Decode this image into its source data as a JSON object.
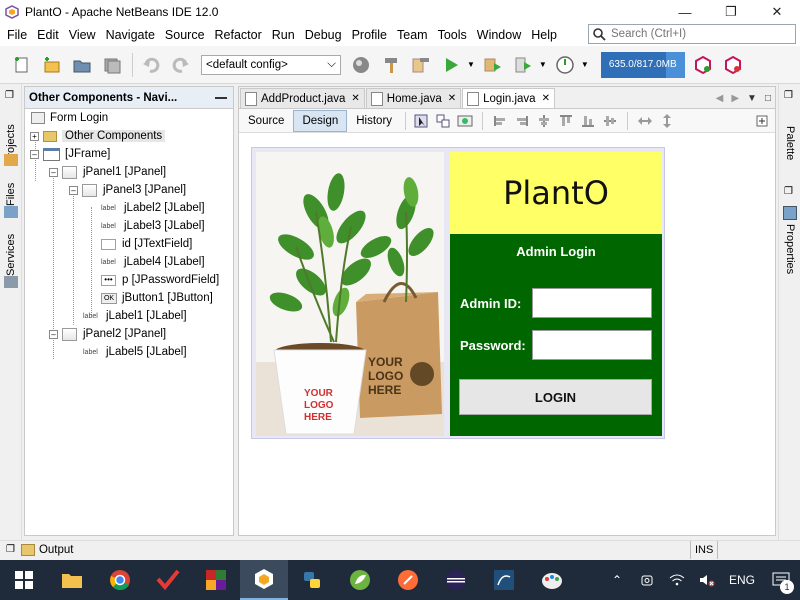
{
  "window": {
    "title": "PlantO - Apache NetBeans IDE 12.0",
    "buttons": [
      "minimize",
      "maximize",
      "close"
    ]
  },
  "menu": {
    "items": [
      "File",
      "Edit",
      "View",
      "Navigate",
      "Source",
      "Refactor",
      "Run",
      "Debug",
      "Profile",
      "Team",
      "Tools",
      "Window",
      "Help"
    ],
    "search_placeholder": "Search (Ctrl+I)"
  },
  "toolbar": {
    "config": "<default config>",
    "memory_text": "635.0/817.0MB",
    "memory_fraction": 0.78
  },
  "left_tabs": [
    "Projects",
    "Files",
    "Services"
  ],
  "right_tabs": [
    "Palette",
    "Properties"
  ],
  "navigator": {
    "title": "Other Components - Navi...",
    "nodes": [
      {
        "label": "Form Login"
      },
      {
        "label": "Other Components"
      },
      {
        "label": "[JFrame]"
      },
      {
        "label": "jPanel1 [JPanel]"
      },
      {
        "label": "jPanel3 [JPanel]"
      },
      {
        "label": "jLabel2 [JLabel]"
      },
      {
        "label": "jLabel3 [JLabel]"
      },
      {
        "label": "id [JTextField]"
      },
      {
        "label": "jLabel4 [JLabel]"
      },
      {
        "label": "p [JPasswordField]"
      },
      {
        "label": "jButton1 [JButton]"
      },
      {
        "label": "jLabel1 [JLabel]"
      },
      {
        "label": "jPanel2 [JPanel]"
      },
      {
        "label": "jLabel5 [JLabel]"
      }
    ],
    "icon_label_text": "label",
    "icon_button_text": "OK"
  },
  "editor": {
    "tabs": [
      "AddProduct.java",
      "Home.java",
      "Login.java"
    ],
    "active_tab": "Login.java",
    "view_tabs": [
      "Source",
      "Design",
      "History"
    ],
    "active_view": "Design"
  },
  "form": {
    "brand": "PlantO",
    "admin_title": "Admin Login",
    "admin_id_label": "Admin ID:",
    "password_label": "Password:",
    "login_button": "LOGIN",
    "pot_text_1": "YOUR",
    "pot_text_2": "LOGO",
    "pot_text_3": "HERE",
    "bag_text_1": "YOUR",
    "bag_text_2": "LOGO",
    "bag_text_3": "HERE"
  },
  "status": {
    "output_label": "Output",
    "ins": "INS"
  },
  "taskbar": {
    "language": "ENG",
    "notification_count": "1"
  }
}
